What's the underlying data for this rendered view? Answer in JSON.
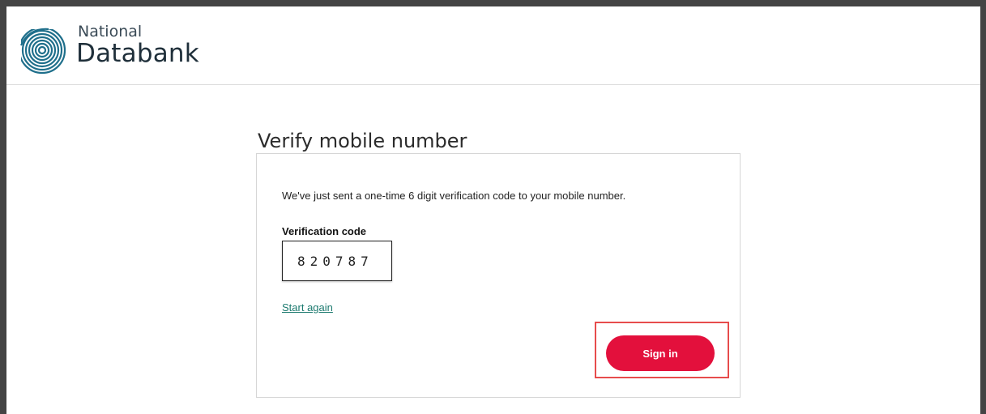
{
  "brand": {
    "line1": "National",
    "line2": "Databank",
    "logo_icon": "fingerprint-icon",
    "logo_color": "#1f6f8b"
  },
  "page_title": "Verify mobile number",
  "card": {
    "info_text": "We've just sent a one-time 6 digit verification code to your mobile number.",
    "code_label": "Verification code",
    "code_value": "820787",
    "start_again_label": "Start again",
    "sign_in_label": "Sign in"
  },
  "colors": {
    "sign_in_button": "#e3103c",
    "link": "#1c7a6f",
    "highlight_border": "#e74c4c"
  }
}
